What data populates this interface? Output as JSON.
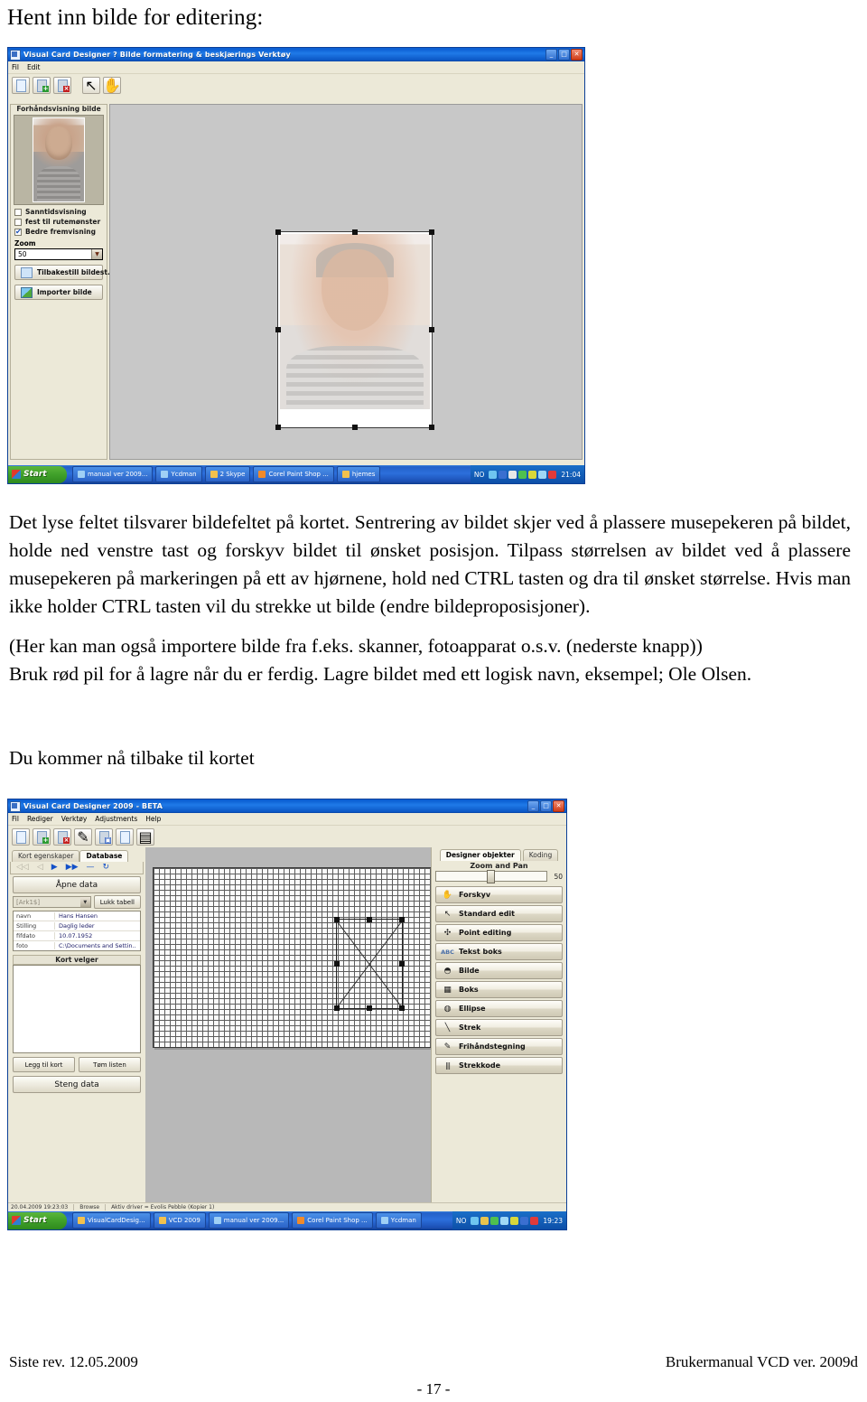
{
  "document": {
    "heading": "Hent inn bilde for editering:",
    "paragraph1": "Det lyse feltet tilsvarer bildefeltet på kortet. Sentrering av bildet skjer ved å plassere musepekeren på bildet, holde ned venstre tast og forskyv bildet til ønsket posisjon. Tilpass størrelsen av bildet ved å plassere musepekeren på markeringen på ett av hjørnene, hold ned CTRL tasten og dra til ønsket størrelse. Hvis man ikke holder CTRL tasten vil du strekke ut bilde (endre bildeproposisjoner).",
    "paragraph2_line1": "(Her kan man også importere bilde fra f.eks. skanner, fotoapparat o.s.v. (nederste knapp))",
    "paragraph2_line2": "Bruk rød pil for å lagre når du er ferdig. Lagre bildet med ett logisk navn, eksempel; Ole Olsen.",
    "paragraph3": "Du kommer nå tilbake til kortet",
    "footer": {
      "left": "Siste rev. 12.05.2009",
      "right": "Brukermanual VCD ver. 2009d",
      "page": "- 17 -"
    }
  },
  "screenshot1": {
    "title": "Visual Card Designer ? Bilde formatering & beskjærings Verktøy",
    "window_buttons": {
      "minimize": "_",
      "maximize": "□",
      "close": "✕"
    },
    "menu": [
      "Fil",
      "Edit"
    ],
    "toolbar": [
      {
        "name": "new-document-icon",
        "badge": ""
      },
      {
        "name": "import-image-icon",
        "badge": "+"
      },
      {
        "name": "save-image-icon",
        "badge": "×"
      },
      {
        "name": "select-arrow-icon",
        "badge": ""
      },
      {
        "name": "pan-hand-icon",
        "badge": ""
      }
    ],
    "preview_header": "Forhåndsvisning bilde",
    "checkboxes": [
      {
        "label": "Sanntidsvisning",
        "checked": false
      },
      {
        "label": "fest til rutemønster",
        "checked": false
      },
      {
        "label": "Bedre fremvisning",
        "checked": true
      }
    ],
    "zoom_label": "Zoom",
    "zoom_value": "50",
    "buttons": [
      {
        "label": "Tilbakestill bildest...",
        "icon": "reset-image-icon"
      },
      {
        "label": "Importer bilde",
        "icon": "import-photo-icon"
      }
    ],
    "taskbar": {
      "start": "Start",
      "items": [
        "manual ver 2009...",
        "Ycdman",
        "2 Skype",
        "Corel Paint Shop ...",
        "hjemes"
      ],
      "lang": "NO",
      "time": "21:04"
    }
  },
  "screenshot2": {
    "title": "Visual Card Designer 2009 - BETA",
    "window_buttons": {
      "minimize": "_",
      "maximize": "□",
      "close": "✕"
    },
    "menu": [
      "Fil",
      "Rediger",
      "Verktøy",
      "Adjustments",
      "Help"
    ],
    "toolbar": [
      {
        "name": "new-document-icon"
      },
      {
        "name": "open-document-icon"
      },
      {
        "name": "save-document-icon"
      },
      {
        "name": "edit-pen-icon"
      },
      {
        "name": "import-image-icon"
      },
      {
        "name": "copy-icon"
      },
      {
        "name": "properties-icon"
      }
    ],
    "left_panel": {
      "tabs": [
        {
          "label": "Kort egenskaper",
          "active": false
        },
        {
          "label": "Database",
          "active": true
        }
      ],
      "nav_buttons": [
        "◁◁",
        "◁",
        "▶",
        "▶▶",
        "—",
        "↻"
      ],
      "open_data_button": "Åpne data",
      "table_select_value": "[Ark1$]",
      "close_table_button": "Lukk tabell",
      "fields": [
        {
          "key": "navn",
          "value": "Hans Hansen"
        },
        {
          "key": "Stilling",
          "value": "Daglig leder"
        },
        {
          "key": "fifdato",
          "value": "10.07.1952"
        },
        {
          "key": "foto",
          "value": "C:\\Documents and Settin.."
        }
      ],
      "card_selector_header": "Kort velger",
      "add_card_button": "Legg til kort",
      "clear_list_button": "Tøm listen",
      "close_data_button": "Steng data"
    },
    "right_panel": {
      "tabs": [
        {
          "label": "Designer objekter",
          "active": true
        },
        {
          "label": "Koding",
          "active": false
        }
      ],
      "zoom_label": "Zoom and Pan",
      "zoom_value": "50",
      "objects": [
        {
          "label": "Forskyv",
          "icon": "pan-hand-icon",
          "glyph": "✋"
        },
        {
          "label": "Standard edit",
          "icon": "select-arrow-icon",
          "glyph": "↖"
        },
        {
          "label": "Point editing",
          "icon": "point-edit-icon",
          "glyph": "✣"
        },
        {
          "label": "Tekst boks",
          "icon": "text-box-icon",
          "glyph": "ABC"
        },
        {
          "label": "Bilde",
          "icon": "image-icon",
          "glyph": "◓"
        },
        {
          "label": "Boks",
          "icon": "box-icon",
          "glyph": "▦"
        },
        {
          "label": "Ellipse",
          "icon": "ellipse-icon",
          "glyph": "◍"
        },
        {
          "label": "Strek",
          "icon": "line-icon",
          "glyph": "╲"
        },
        {
          "label": "Frihåndstegning",
          "icon": "freehand-icon",
          "glyph": "✎"
        },
        {
          "label": "Strekkode",
          "icon": "barcode-icon",
          "glyph": "|||"
        }
      ]
    },
    "status_bar": {
      "timestamp": "20.04.2009 19:23:03",
      "mode": "Browse",
      "driver": "Aktiv driver = Evolis Pebble (Kopier 1)"
    },
    "taskbar": {
      "start": "Start",
      "items": [
        "VisualCardDesig...",
        "VCD 2009",
        "manual ver 2009...",
        "Corel Paint Shop ...",
        "Ycdman"
      ],
      "lang": "NO",
      "time": "19:23"
    }
  }
}
